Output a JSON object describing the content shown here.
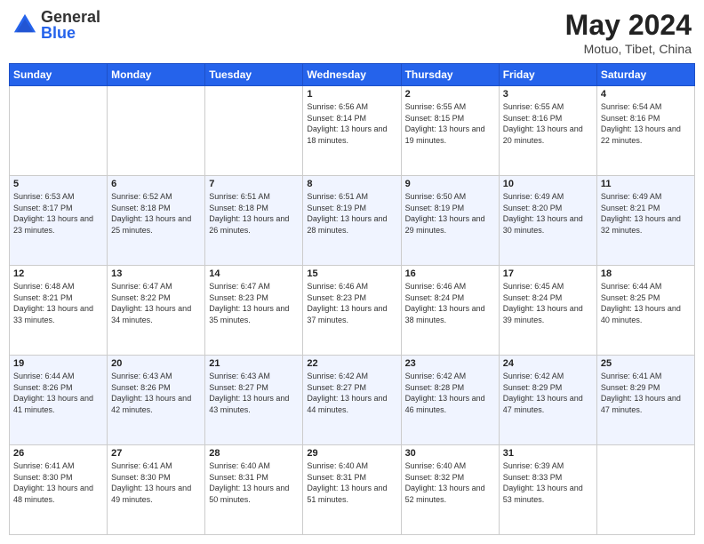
{
  "header": {
    "logo_general": "General",
    "logo_blue": "Blue",
    "title": "May 2024",
    "location": "Motuo, Tibet, China"
  },
  "days_of_week": [
    "Sunday",
    "Monday",
    "Tuesday",
    "Wednesday",
    "Thursday",
    "Friday",
    "Saturday"
  ],
  "weeks": [
    [
      {
        "day": "",
        "info": ""
      },
      {
        "day": "",
        "info": ""
      },
      {
        "day": "",
        "info": ""
      },
      {
        "day": "1",
        "info": "Sunrise: 6:56 AM\nSunset: 8:14 PM\nDaylight: 13 hours\nand 18 minutes."
      },
      {
        "day": "2",
        "info": "Sunrise: 6:55 AM\nSunset: 8:15 PM\nDaylight: 13 hours\nand 19 minutes."
      },
      {
        "day": "3",
        "info": "Sunrise: 6:55 AM\nSunset: 8:16 PM\nDaylight: 13 hours\nand 20 minutes."
      },
      {
        "day": "4",
        "info": "Sunrise: 6:54 AM\nSunset: 8:16 PM\nDaylight: 13 hours\nand 22 minutes."
      }
    ],
    [
      {
        "day": "5",
        "info": "Sunrise: 6:53 AM\nSunset: 8:17 PM\nDaylight: 13 hours\nand 23 minutes."
      },
      {
        "day": "6",
        "info": "Sunrise: 6:52 AM\nSunset: 8:18 PM\nDaylight: 13 hours\nand 25 minutes."
      },
      {
        "day": "7",
        "info": "Sunrise: 6:51 AM\nSunset: 8:18 PM\nDaylight: 13 hours\nand 26 minutes."
      },
      {
        "day": "8",
        "info": "Sunrise: 6:51 AM\nSunset: 8:19 PM\nDaylight: 13 hours\nand 28 minutes."
      },
      {
        "day": "9",
        "info": "Sunrise: 6:50 AM\nSunset: 8:19 PM\nDaylight: 13 hours\nand 29 minutes."
      },
      {
        "day": "10",
        "info": "Sunrise: 6:49 AM\nSunset: 8:20 PM\nDaylight: 13 hours\nand 30 minutes."
      },
      {
        "day": "11",
        "info": "Sunrise: 6:49 AM\nSunset: 8:21 PM\nDaylight: 13 hours\nand 32 minutes."
      }
    ],
    [
      {
        "day": "12",
        "info": "Sunrise: 6:48 AM\nSunset: 8:21 PM\nDaylight: 13 hours\nand 33 minutes."
      },
      {
        "day": "13",
        "info": "Sunrise: 6:47 AM\nSunset: 8:22 PM\nDaylight: 13 hours\nand 34 minutes."
      },
      {
        "day": "14",
        "info": "Sunrise: 6:47 AM\nSunset: 8:23 PM\nDaylight: 13 hours\nand 35 minutes."
      },
      {
        "day": "15",
        "info": "Sunrise: 6:46 AM\nSunset: 8:23 PM\nDaylight: 13 hours\nand 37 minutes."
      },
      {
        "day": "16",
        "info": "Sunrise: 6:46 AM\nSunset: 8:24 PM\nDaylight: 13 hours\nand 38 minutes."
      },
      {
        "day": "17",
        "info": "Sunrise: 6:45 AM\nSunset: 8:24 PM\nDaylight: 13 hours\nand 39 minutes."
      },
      {
        "day": "18",
        "info": "Sunrise: 6:44 AM\nSunset: 8:25 PM\nDaylight: 13 hours\nand 40 minutes."
      }
    ],
    [
      {
        "day": "19",
        "info": "Sunrise: 6:44 AM\nSunset: 8:26 PM\nDaylight: 13 hours\nand 41 minutes."
      },
      {
        "day": "20",
        "info": "Sunrise: 6:43 AM\nSunset: 8:26 PM\nDaylight: 13 hours\nand 42 minutes."
      },
      {
        "day": "21",
        "info": "Sunrise: 6:43 AM\nSunset: 8:27 PM\nDaylight: 13 hours\nand 43 minutes."
      },
      {
        "day": "22",
        "info": "Sunrise: 6:42 AM\nSunset: 8:27 PM\nDaylight: 13 hours\nand 44 minutes."
      },
      {
        "day": "23",
        "info": "Sunrise: 6:42 AM\nSunset: 8:28 PM\nDaylight: 13 hours\nand 46 minutes."
      },
      {
        "day": "24",
        "info": "Sunrise: 6:42 AM\nSunset: 8:29 PM\nDaylight: 13 hours\nand 47 minutes."
      },
      {
        "day": "25",
        "info": "Sunrise: 6:41 AM\nSunset: 8:29 PM\nDaylight: 13 hours\nand 47 minutes."
      }
    ],
    [
      {
        "day": "26",
        "info": "Sunrise: 6:41 AM\nSunset: 8:30 PM\nDaylight: 13 hours\nand 48 minutes."
      },
      {
        "day": "27",
        "info": "Sunrise: 6:41 AM\nSunset: 8:30 PM\nDaylight: 13 hours\nand 49 minutes."
      },
      {
        "day": "28",
        "info": "Sunrise: 6:40 AM\nSunset: 8:31 PM\nDaylight: 13 hours\nand 50 minutes."
      },
      {
        "day": "29",
        "info": "Sunrise: 6:40 AM\nSunset: 8:31 PM\nDaylight: 13 hours\nand 51 minutes."
      },
      {
        "day": "30",
        "info": "Sunrise: 6:40 AM\nSunset: 8:32 PM\nDaylight: 13 hours\nand 52 minutes."
      },
      {
        "day": "31",
        "info": "Sunrise: 6:39 AM\nSunset: 8:33 PM\nDaylight: 13 hours\nand 53 minutes."
      },
      {
        "day": "",
        "info": ""
      }
    ]
  ]
}
